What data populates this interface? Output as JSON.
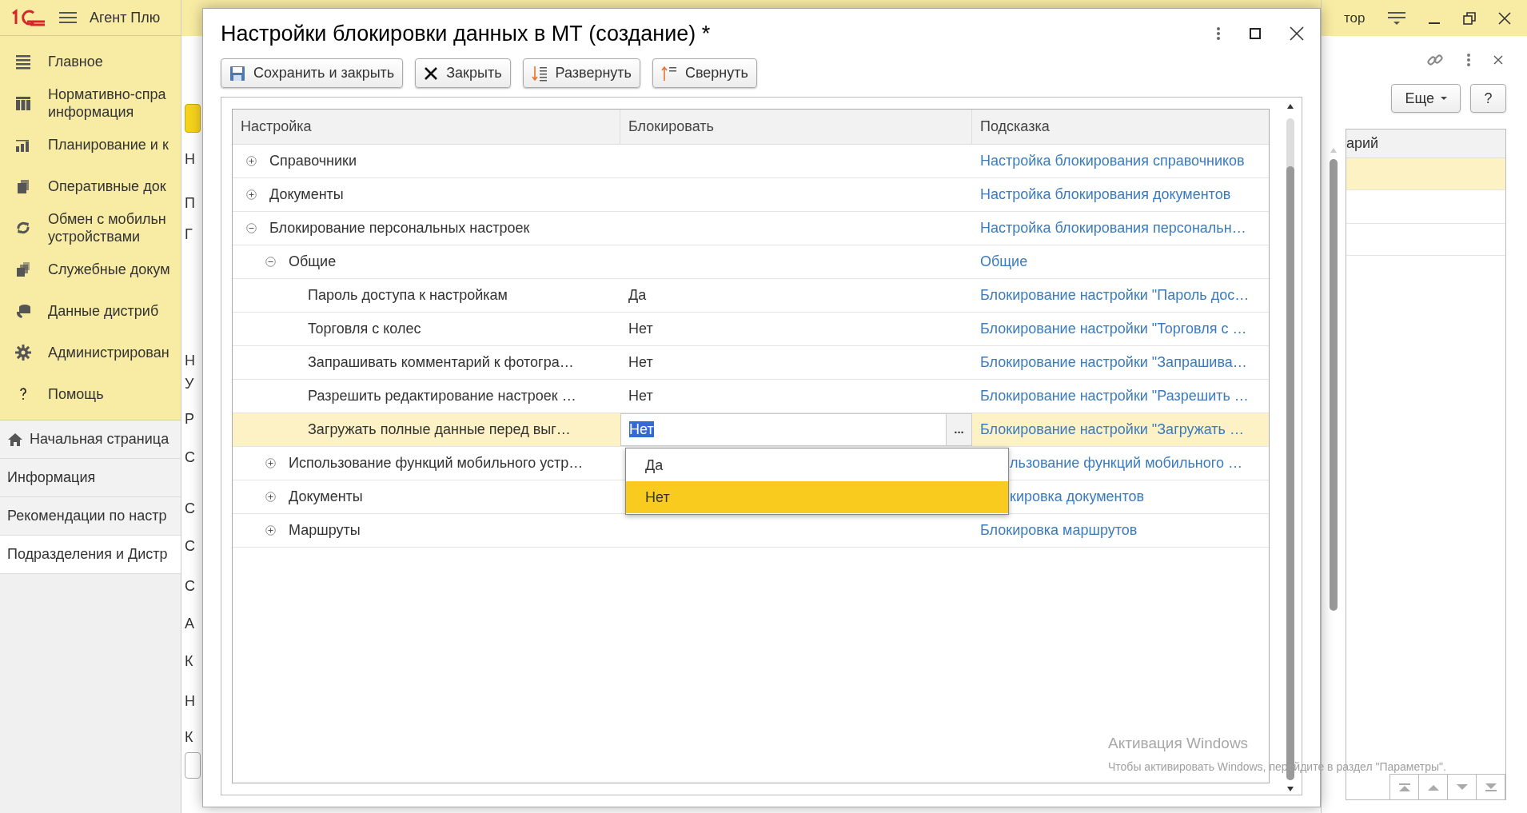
{
  "app_header": {
    "title": "Агент Плю"
  },
  "sidebar": {
    "items": [
      {
        "label": "Главное"
      },
      {
        "label": "Нормативно-спра\nинформация"
      },
      {
        "label": "Планирование и к"
      },
      {
        "label": "Оперативные док"
      },
      {
        "label": "Обмен с мобильн\nустройствами"
      },
      {
        "label": "Служебные докум"
      },
      {
        "label": "Данные дистриб"
      },
      {
        "label": "Администрирован"
      },
      {
        "label": "Помощь"
      }
    ]
  },
  "open_pages": [
    {
      "label": "Начальная страница",
      "selected": false
    },
    {
      "label": "Информация",
      "selected": false
    },
    {
      "label": "Рекомендации по настр",
      "selected": false
    },
    {
      "label": "Подразделения и Дистр",
      "selected": true
    }
  ],
  "background_form": {
    "labels": [
      "Н",
      "П",
      "Г",
      "Н",
      "У",
      "Р",
      "С",
      "С",
      "С",
      "С",
      "А",
      "К",
      "Н",
      "К"
    ]
  },
  "right_panel": {
    "title": "тор",
    "more_button": "Еще",
    "help_button": "?",
    "column_header": "арий"
  },
  "dialog": {
    "title": "Настройки блокировки данных в МТ (создание) *",
    "toolbar": [
      {
        "label": "Сохранить и закрыть"
      },
      {
        "label": "Закрыть"
      },
      {
        "label": "Развернуть"
      },
      {
        "label": "Свернуть"
      }
    ],
    "table": {
      "columns": [
        "Настройка",
        "Блокировать",
        "Подсказка"
      ],
      "rows": [
        {
          "label": "Справочники",
          "hint": "Настройка блокирования справочников",
          "expanded": false,
          "selected": false
        },
        {
          "label": "Документы",
          "hint": "Настройка блокирования документов",
          "expanded": false,
          "selected": false
        },
        {
          "label": "Блокирование персональных настроек",
          "hint": "Настройка блокирования персональн…",
          "expanded": true,
          "selected": false,
          "children": [
            {
              "label": "Общие",
              "hint": "Общие",
              "expanded": true,
              "selected": false,
              "children": [
                {
                  "label": "Пароль доступа к настройкам",
                  "value": "Да",
                  "hint": "Блокирование настройки \"Пароль дос…",
                  "selected": false
                },
                {
                  "label": "Торговля с колес",
                  "value": "Нет",
                  "hint": "Блокирование настройки \"Торговля с …",
                  "selected": false
                },
                {
                  "label": "Запрашивать комментарий к фотогра…",
                  "value": "Нет",
                  "hint": "Блокирование настройки \"Запрашива…",
                  "selected": false
                },
                {
                  "label": "Разрешить редактирование настроек …",
                  "value": "Нет",
                  "hint": "Блокирование настройки \"Разрешить …",
                  "selected": false
                },
                {
                  "label": "Загружать полные данные перед выг…",
                  "value": "Нет",
                  "hint": "Блокирование настройки \"Загружать …",
                  "selected": true
                }
              ]
            },
            {
              "label": "Использование функций мобильного устр…",
              "hint": "льзование функций мобильного …",
              "expanded": false,
              "selected": false
            },
            {
              "label": "Документы",
              "hint": "кировка документов",
              "expanded": false,
              "selected": false
            },
            {
              "label": "Маршруты",
              "hint": "Блокировка маршрутов",
              "expanded": false,
              "selected": false
            }
          ]
        }
      ]
    },
    "editor_button": "...",
    "dropdown": {
      "options": [
        {
          "label": "Да",
          "selected": false
        },
        {
          "label": "Нет",
          "selected": true
        }
      ]
    }
  },
  "os_notice": {
    "title": "Активация Windows",
    "text": "Чтобы активировать Windows, перейдите в раздел \"Параметры\"."
  }
}
